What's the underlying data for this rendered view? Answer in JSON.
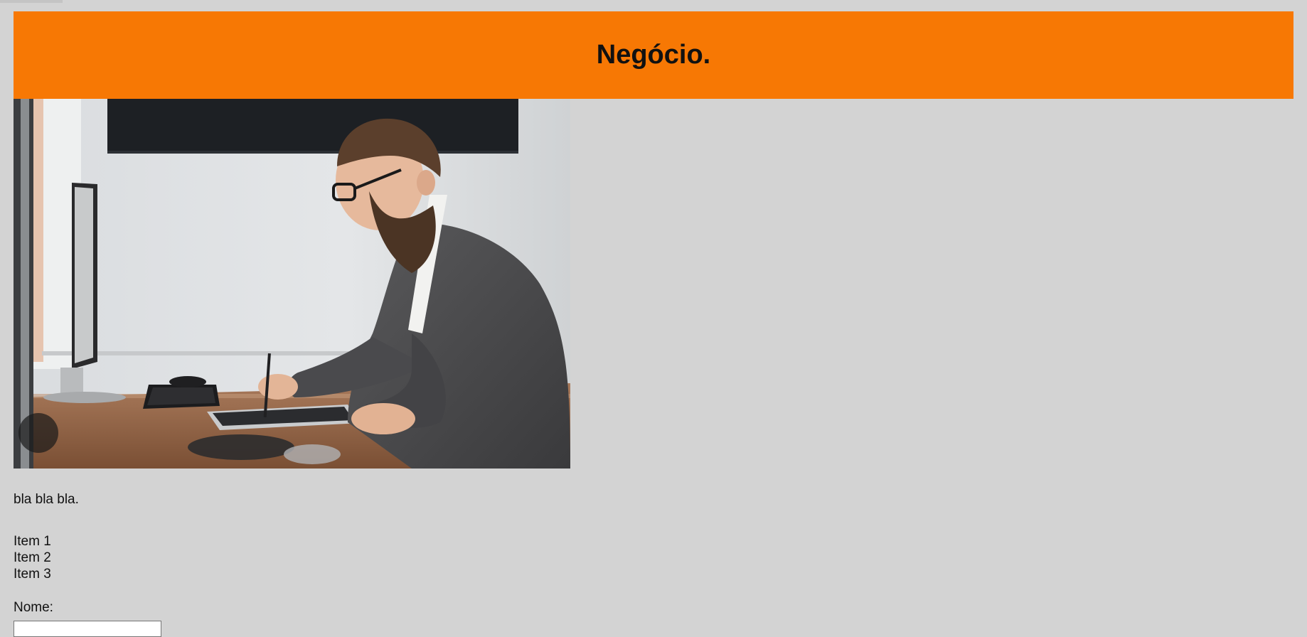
{
  "header": {
    "title": "Negócio.",
    "background_color": "#f77804"
  },
  "photo": {
    "alt": "man in glasses and blazer writing on a tablet at an office desk with a computer monitor and keyboard"
  },
  "content": {
    "paragraph": "bla bla bla.",
    "list_items": [
      "Item 1",
      "Item 2",
      "Item 3"
    ]
  },
  "form": {
    "name_label": "Nome:",
    "name_value": ""
  }
}
